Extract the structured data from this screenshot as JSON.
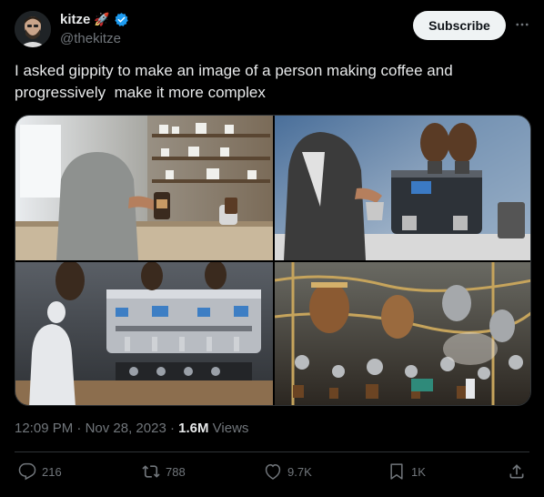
{
  "author": {
    "name": "kitze",
    "handle": "@thekitze",
    "badge_emoji": "🚀",
    "verified": true,
    "avatar_icon": "avatar-photo"
  },
  "subscribe_label": "Subscribe",
  "more_icon": "more-icon",
  "tweet_text": "I asked gippity to make an image of a person making coffee and progressively  make it more complex",
  "media": [
    {
      "icon": "coffee-kitchen-image"
    },
    {
      "icon": "espresso-machine-image"
    },
    {
      "icon": "complex-espresso-machine-image"
    },
    {
      "icon": "steampunk-coffee-factory-image"
    }
  ],
  "meta": {
    "time": "12:09 PM",
    "separator": "·",
    "date": "Nov 28, 2023",
    "views_count": "1.6M",
    "views_label": "Views"
  },
  "actions": {
    "replies": "216",
    "reposts": "788",
    "likes": "9.7K",
    "bookmarks": "1K"
  },
  "colors": {
    "background": "#000000",
    "text": "#e7e9ea",
    "muted": "#71767b",
    "verified": "#1d9bf0",
    "button_bg": "#eff3f4"
  }
}
